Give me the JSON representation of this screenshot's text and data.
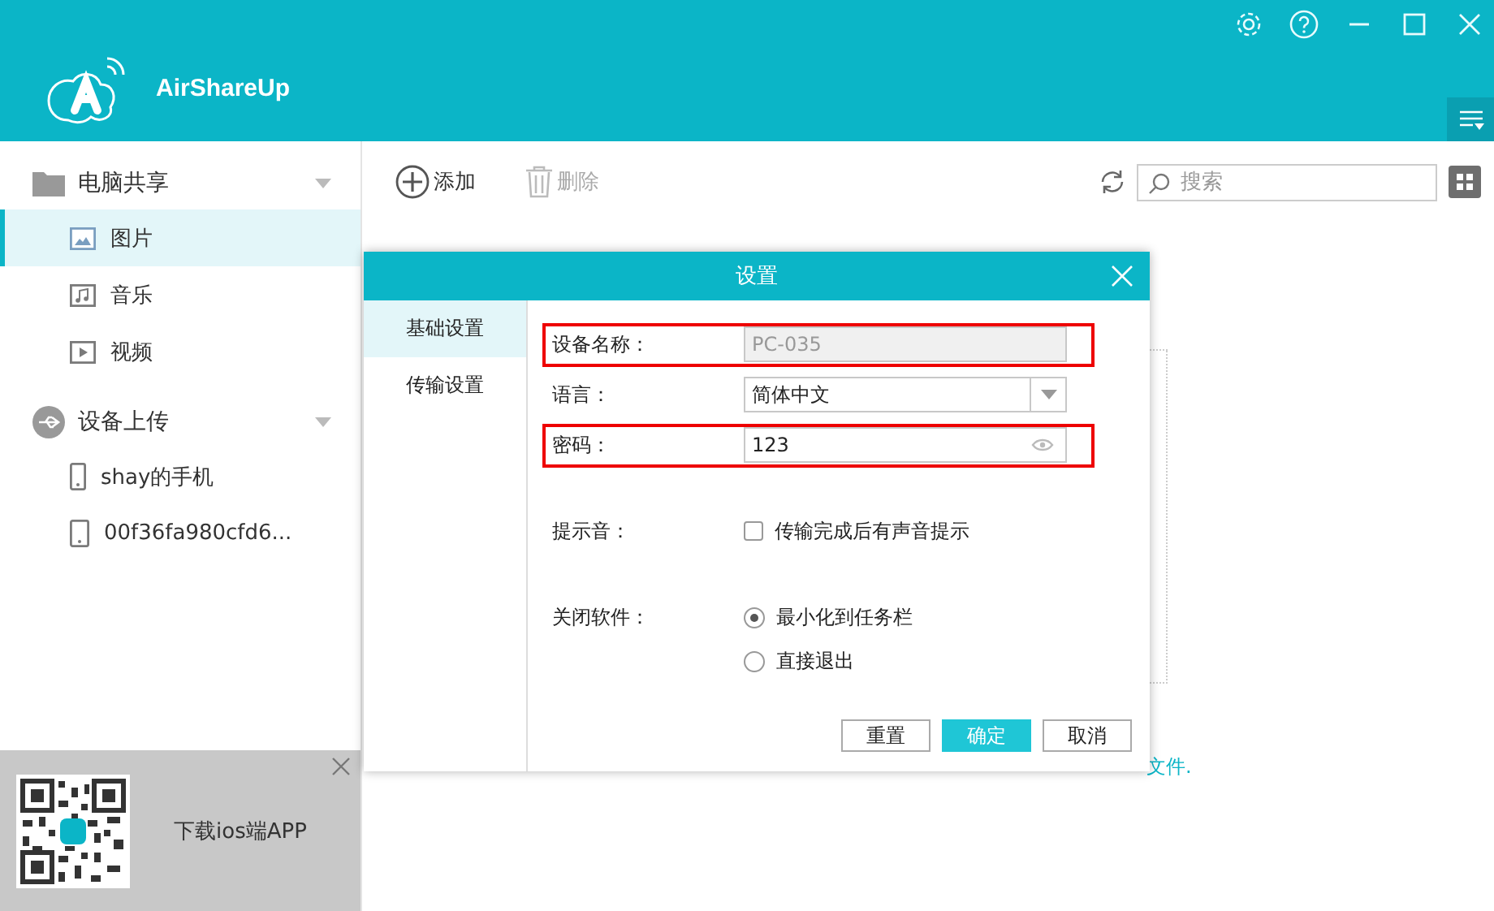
{
  "app": {
    "title": "AirShareUp"
  },
  "sidebar": {
    "groups": [
      {
        "label": "电脑共享",
        "items": [
          {
            "label": "图片",
            "selected": true
          },
          {
            "label": "音乐",
            "selected": false
          },
          {
            "label": "视频",
            "selected": false
          }
        ]
      },
      {
        "label": "设备上传",
        "items": [
          {
            "label": "shay的手机",
            "selected": false
          },
          {
            "label": "00f36fa980cfd6...",
            "selected": false
          }
        ]
      }
    ]
  },
  "promo": {
    "text": "下载ios端APP"
  },
  "toolbar": {
    "add": "添加",
    "delete": "删除",
    "delete_disabled": true,
    "search_placeholder": "搜索"
  },
  "background_hint": "文件.",
  "dialog": {
    "title": "设置",
    "tabs": [
      {
        "label": "基础设置",
        "selected": true
      },
      {
        "label": "传输设置",
        "selected": false
      }
    ],
    "fields": [
      {
        "kind": "text",
        "label": "设备名称：",
        "value": "PC-035",
        "disabled": true,
        "highlighted": true
      },
      {
        "kind": "select",
        "label": "语言：",
        "value": "简体中文",
        "highlighted": false
      },
      {
        "kind": "password",
        "label": "密码：",
        "value": "123",
        "highlighted": true
      },
      {
        "kind": "checkbox",
        "label": "提示音：",
        "option": "传输完成后有声音提示",
        "checked": false
      },
      {
        "kind": "radio",
        "label": "关闭软件：",
        "options": [
          {
            "label": "最小化到任务栏",
            "selected": true
          },
          {
            "label": "直接退出",
            "selected": false
          }
        ]
      }
    ],
    "buttons": [
      {
        "label": "重置",
        "primary": false
      },
      {
        "label": "确定",
        "primary": true
      },
      {
        "label": "取消",
        "primary": false
      }
    ]
  }
}
